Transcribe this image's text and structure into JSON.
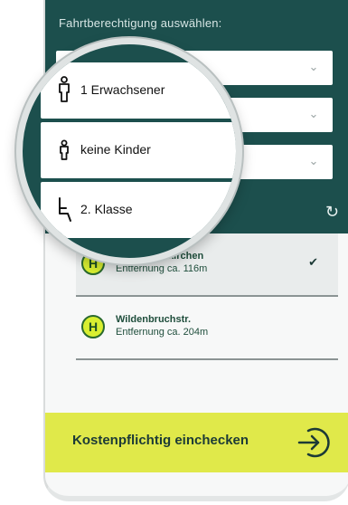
{
  "header": {
    "title": "Fahrtberechtigung auswählen:"
  },
  "selectors": [
    {
      "label": "1 Erwachsener",
      "icon": "adult-person-icon"
    },
    {
      "label": "keine Kinder",
      "icon": "child-person-icon"
    },
    {
      "label": "2. Klasse",
      "icon": "seat-icon"
    }
  ],
  "stops": [
    {
      "name": "Hbf Gelsenkirchen",
      "distance": "Entfernung ca. 116m",
      "selected": true
    },
    {
      "name": "Wildenbruchstr.",
      "distance": "Entfernung ca. 204m",
      "selected": false
    }
  ],
  "stop_badge": "H",
  "checkin": {
    "label": "Kostenpflichtig einchecken"
  },
  "icons": {
    "chevron": "chevron-down-icon",
    "refresh": "refresh-icon",
    "check": "check-icon",
    "enter": "enter-arrow-icon"
  },
  "colors": {
    "header_bg": "#1c4f4d",
    "accent_yellow": "#e0e94a",
    "badge_fill": "#d9ef31"
  }
}
